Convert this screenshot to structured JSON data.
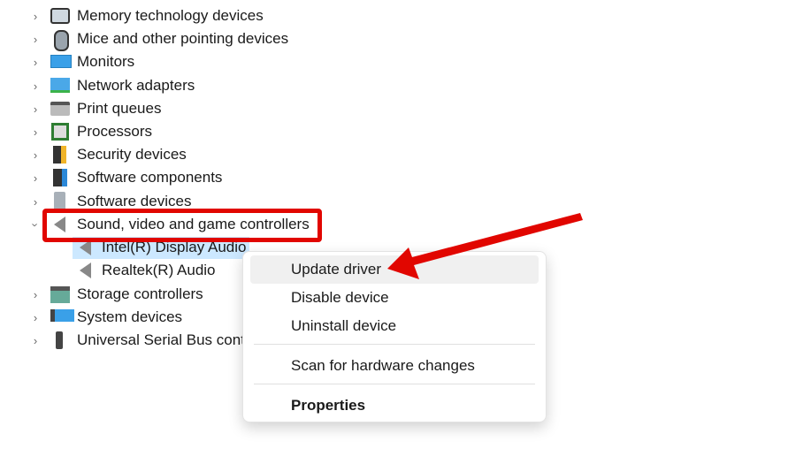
{
  "tree": {
    "items": [
      {
        "label": "Memory technology devices",
        "icon": "memory-icon",
        "expanded": false
      },
      {
        "label": "Mice and other pointing devices",
        "icon": "mouse-icon",
        "expanded": false
      },
      {
        "label": "Monitors",
        "icon": "monitor-icon",
        "expanded": false
      },
      {
        "label": "Network adapters",
        "icon": "network-icon",
        "expanded": false
      },
      {
        "label": "Print queues",
        "icon": "printer-icon",
        "expanded": false
      },
      {
        "label": "Processors",
        "icon": "processor-icon",
        "expanded": false
      },
      {
        "label": "Security devices",
        "icon": "security-icon",
        "expanded": false
      },
      {
        "label": "Software components",
        "icon": "software-component-icon",
        "expanded": false
      },
      {
        "label": "Software devices",
        "icon": "software-device-icon",
        "expanded": false
      },
      {
        "label": "Sound, video and game controllers",
        "icon": "speaker-icon",
        "expanded": true,
        "children": [
          {
            "label": "Intel(R) Display Audio",
            "selected": true
          },
          {
            "label": "Realtek(R) Audio",
            "selected": false
          }
        ]
      },
      {
        "label": "Storage controllers",
        "icon": "storage-icon",
        "expanded": false
      },
      {
        "label": "System devices",
        "icon": "system-icon",
        "expanded": false
      },
      {
        "label": "Universal Serial Bus cont",
        "icon": "usb-icon",
        "expanded": false
      }
    ]
  },
  "context_menu": {
    "items": [
      "Update driver",
      "Disable device",
      "Uninstall device",
      "Scan for hardware changes",
      "Properties"
    ]
  },
  "colors": {
    "highlight": "#e10600",
    "selection": "#cce8ff"
  }
}
